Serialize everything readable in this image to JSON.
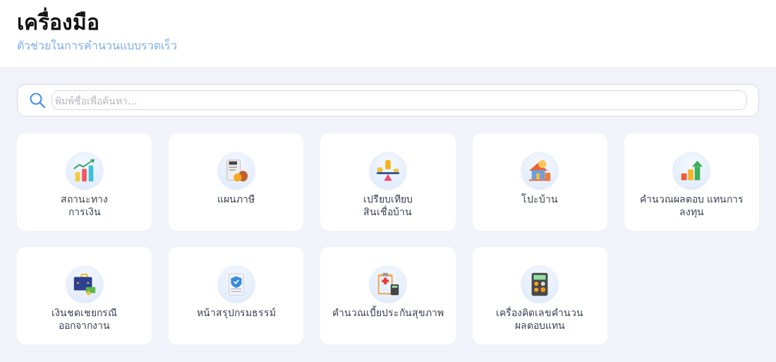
{
  "header": {
    "title": "เครื่องมือ",
    "subtitle": "ตัวช่วยในการคำนวนแบบรวดเร็ว"
  },
  "search": {
    "placeholder": "พิมพ์ชื่อเพื่อค้นหา..."
  },
  "tools": [
    {
      "kind": "chart",
      "label": "สถานะทาง\nการเงิน"
    },
    {
      "kind": "tax",
      "label": "แผนภาษี"
    },
    {
      "kind": "scale",
      "label": "เปรียบเทียบ\nสินเชื่อบ้าน"
    },
    {
      "kind": "house",
      "label": "โปะบ้าน"
    },
    {
      "kind": "growth",
      "label": "คำนวณผลตอบ แทนการ\nลงทุน"
    },
    {
      "kind": "briefcase",
      "label": "เงินชดเชยกรณี\nออกจากงาน"
    },
    {
      "kind": "policy",
      "label": "หน้าสรุปกรมธรรม์"
    },
    {
      "kind": "health",
      "label": "คำนวณเบี้ยประกันสุขภาพ"
    },
    {
      "kind": "calculator",
      "label": "เครื่องคิดเลขคำนวน\nผลตอบแทน"
    }
  ]
}
